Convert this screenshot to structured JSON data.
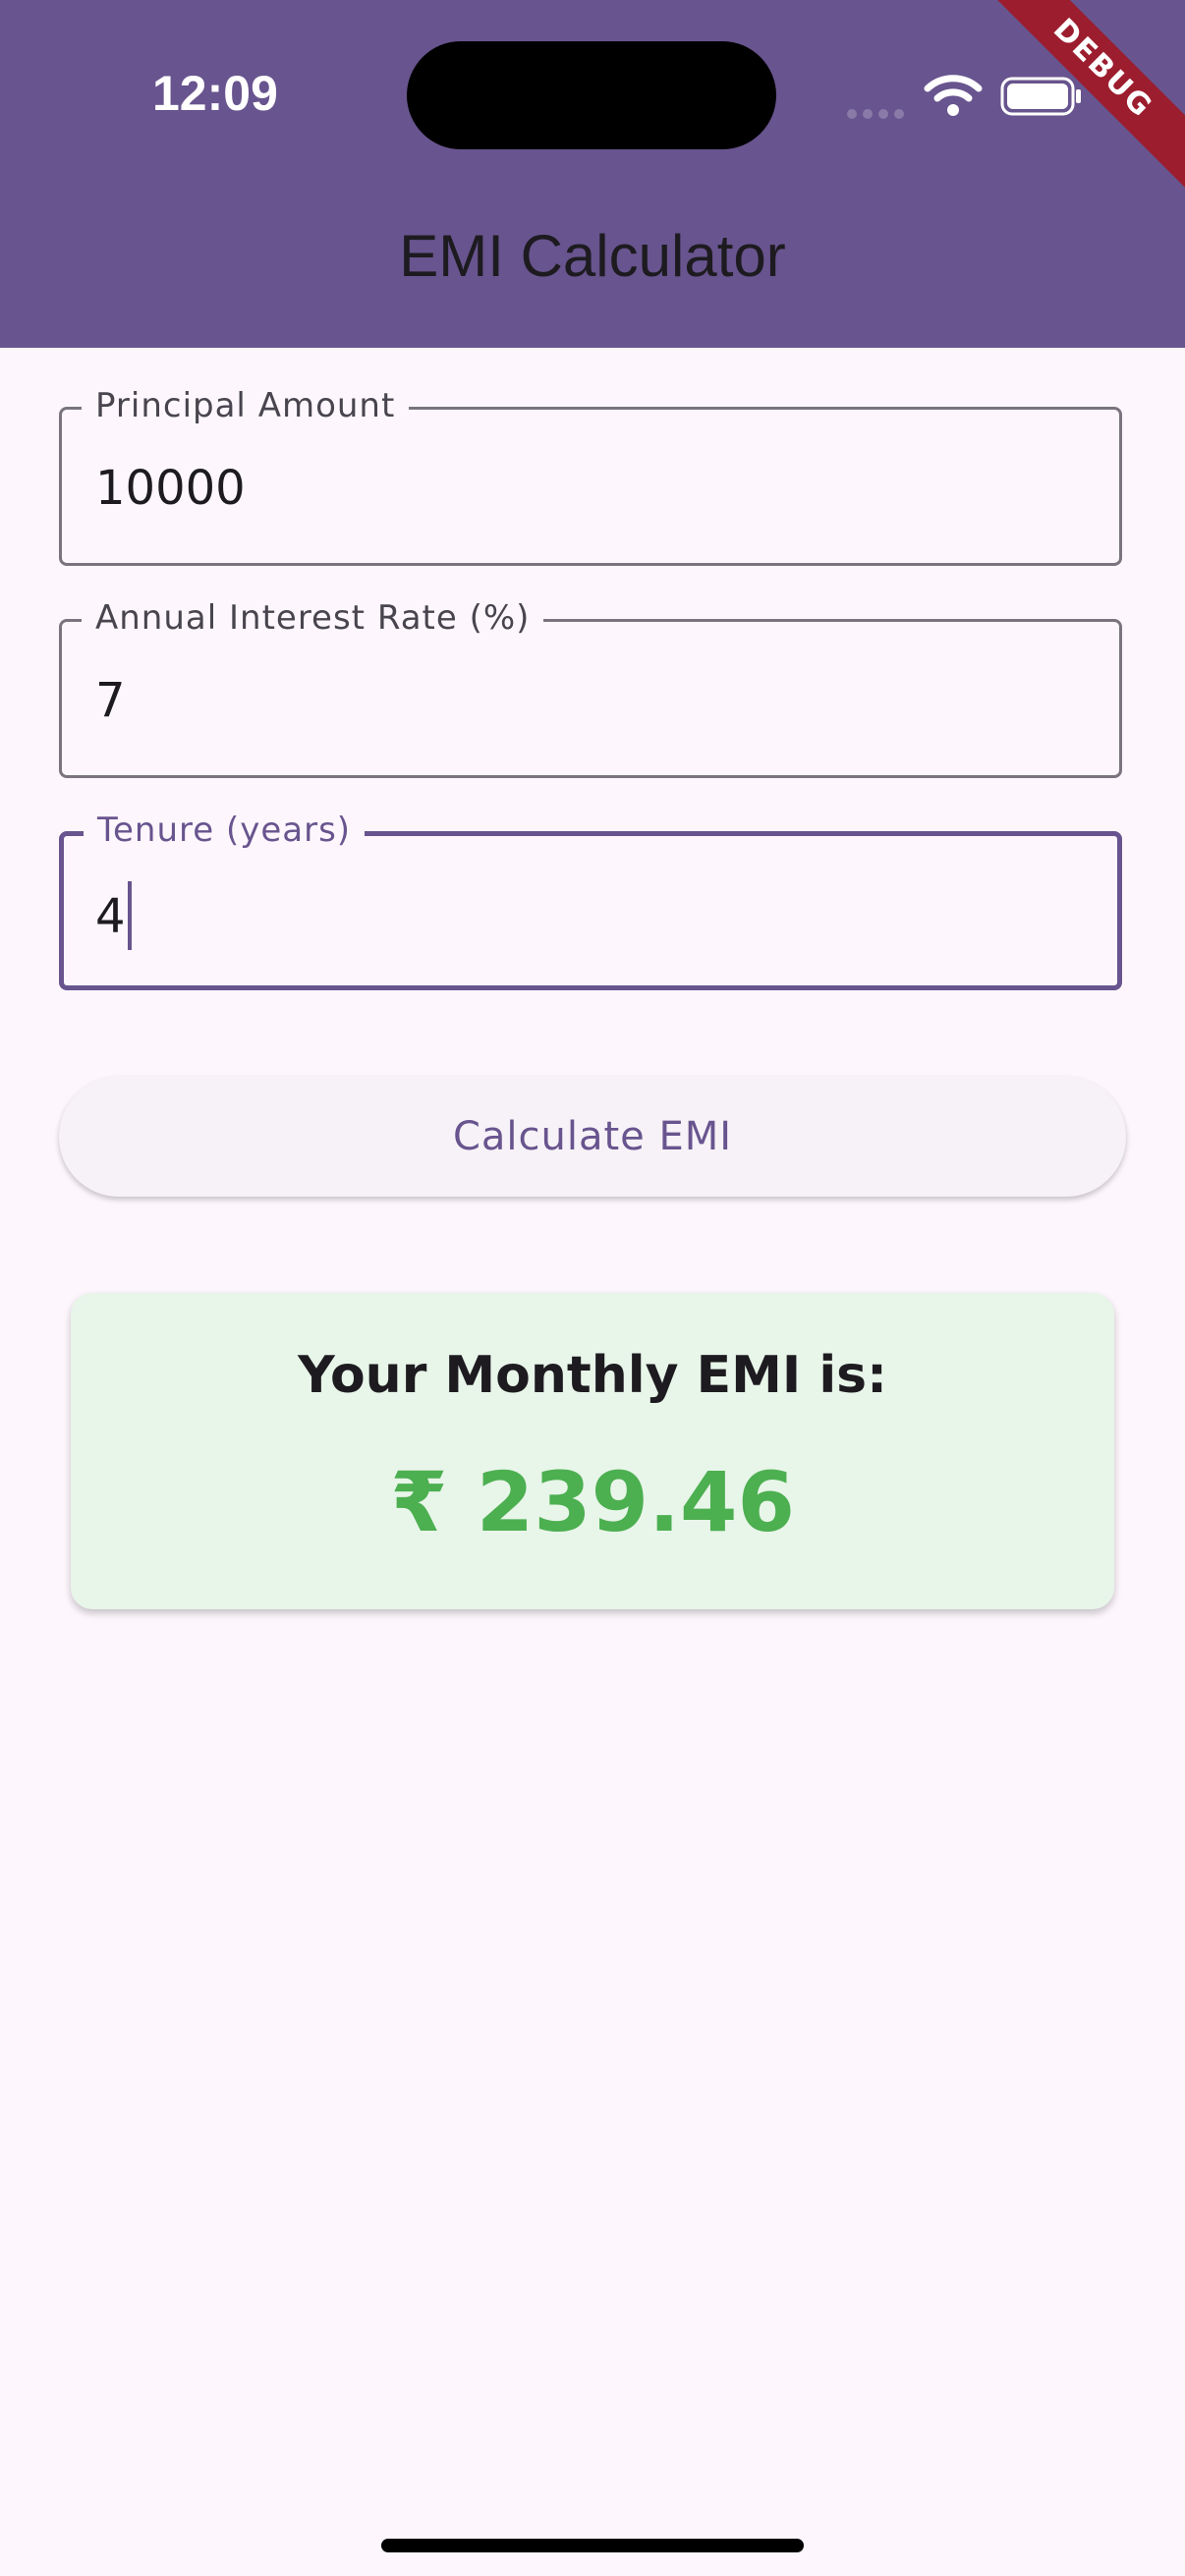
{
  "status_bar": {
    "time": "12:09",
    "icons": [
      "cellular-signal-icon",
      "wifi-icon",
      "battery-icon"
    ]
  },
  "debug_banner": "DEBUG",
  "app_bar": {
    "title": "EMI Calculator",
    "color": "#68548e"
  },
  "form": {
    "principal": {
      "label": "Principal Amount",
      "value": "10000"
    },
    "rate": {
      "label": "Annual Interest Rate (%)",
      "value": "7"
    },
    "tenure": {
      "label": "Tenure (years)",
      "value": "4",
      "focused": true
    }
  },
  "calculate_button": {
    "label": "Calculate EMI"
  },
  "result": {
    "title": "Your Monthly EMI is:",
    "value": "₹ 239.46",
    "value_color": "#4caf50",
    "card_color": "#e8f5e9"
  }
}
